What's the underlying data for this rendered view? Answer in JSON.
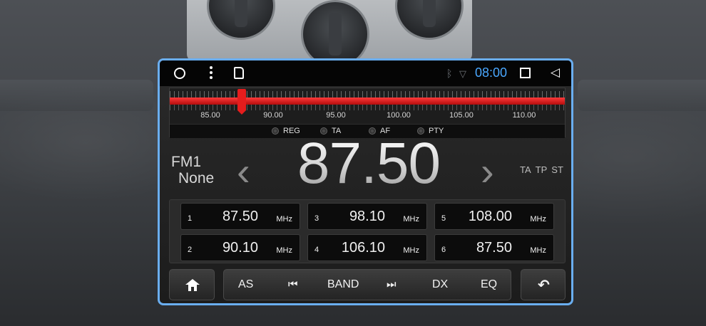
{
  "statusbar": {
    "time": "08:00",
    "icons": [
      "circle-home-icon",
      "more-vert-icon",
      "sd-card-icon",
      "bluetooth-icon",
      "wifi-icon",
      "square-recents-icon",
      "triangle-back-icon"
    ]
  },
  "tuner": {
    "scale_labels": [
      "85.00",
      "90.00",
      "95.00",
      "100.00",
      "105.00",
      "110.00"
    ],
    "options": [
      "REG",
      "TA",
      "AF",
      "PTY"
    ],
    "needle_value": 87.5
  },
  "station": {
    "band": "FM1",
    "name": "None",
    "frequency": "87.50",
    "flags": [
      "TA",
      "TP",
      "ST"
    ]
  },
  "presets": [
    {
      "num": "1",
      "freq": "87.50",
      "unit": "MHz"
    },
    {
      "num": "2",
      "freq": "90.10",
      "unit": "MHz"
    },
    {
      "num": "3",
      "freq": "98.10",
      "unit": "MHz"
    },
    {
      "num": "4",
      "freq": "106.10",
      "unit": "MHz"
    },
    {
      "num": "5",
      "freq": "108.00",
      "unit": "MHz"
    },
    {
      "num": "6",
      "freq": "87.50",
      "unit": "MHz"
    }
  ],
  "controls": {
    "as": "AS",
    "band": "BAND",
    "dx": "DX",
    "eq": "EQ"
  },
  "colors": {
    "accent": "#4aa8ff",
    "frame": "#6aaef0",
    "tuner_bar": "#e51d1d"
  }
}
